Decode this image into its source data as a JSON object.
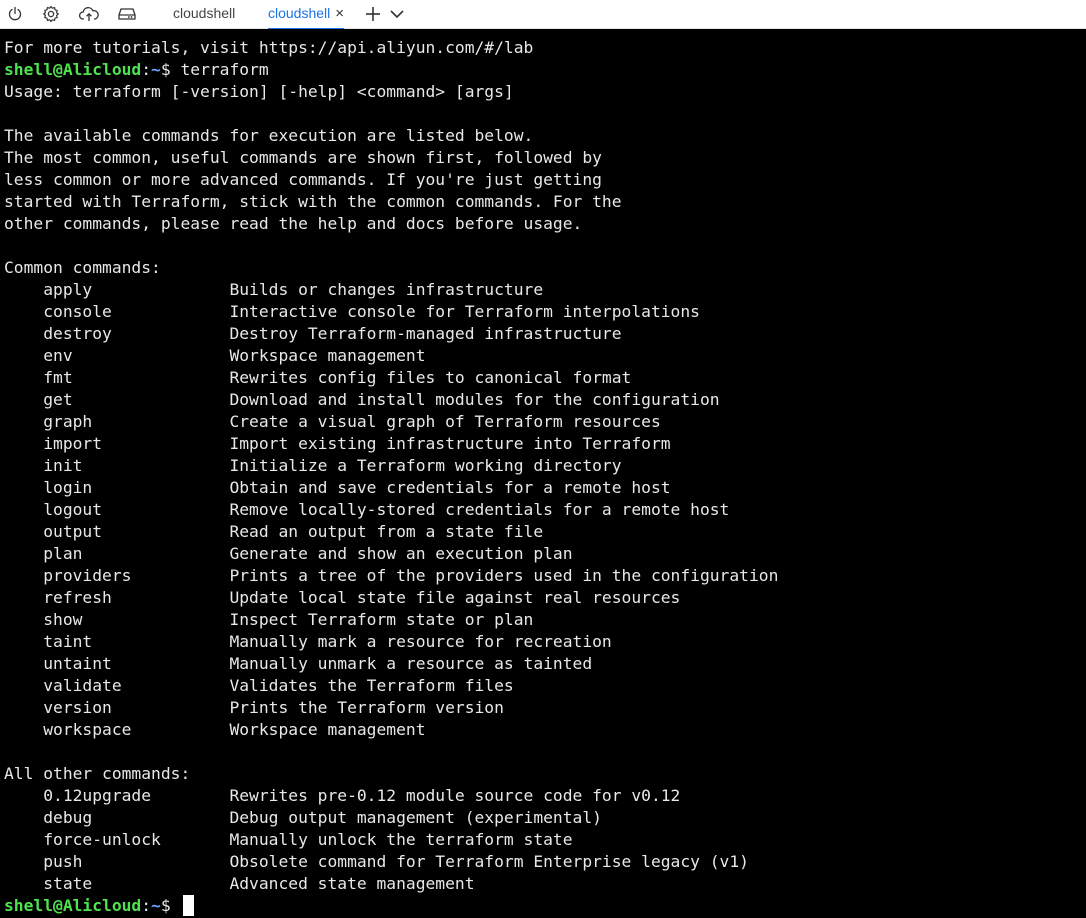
{
  "toolbar": {
    "icons": [
      "power-icon",
      "gear-icon",
      "cloud-upload-icon",
      "drive-icon"
    ],
    "tabs": [
      {
        "label": "cloudshell",
        "active": false
      },
      {
        "label": "cloudshell",
        "active": true,
        "close": "×"
      }
    ],
    "add_label": "+",
    "more_label": "chevron-down",
    "accent_color": "#1a73e8"
  },
  "terminal": {
    "colors": {
      "background": "#000000",
      "text": "#e8e8e8",
      "prompt_user": "#4ee34e",
      "prompt_path": "#6aa0ff"
    },
    "prompt": {
      "user": "shell@Alicloud",
      "path": "~",
      "symbol": "$ "
    },
    "first_command": "terraform",
    "lines": [
      "For more tutorials, visit https://api.aliyun.com/#/lab",
      "",
      "Usage: terraform [-version] [-help] <command> [args]",
      "",
      "The available commands for execution are listed below.",
      "The most common, useful commands are shown first, followed by",
      "less common or more advanced commands. If you're just getting",
      "started with Terraform, stick with the common commands. For the",
      "other commands, please read the help and docs before usage.",
      "",
      "Common commands:",
      "    apply              Builds or changes infrastructure",
      "    console            Interactive console for Terraform interpolations",
      "    destroy            Destroy Terraform-managed infrastructure",
      "    env                Workspace management",
      "    fmt                Rewrites config files to canonical format",
      "    get                Download and install modules for the configuration",
      "    graph              Create a visual graph of Terraform resources",
      "    import             Import existing infrastructure into Terraform",
      "    init               Initialize a Terraform working directory",
      "    login              Obtain and save credentials for a remote host",
      "    logout             Remove locally-stored credentials for a remote host",
      "    output             Read an output from a state file",
      "    plan               Generate and show an execution plan",
      "    providers          Prints a tree of the providers used in the configuration",
      "    refresh            Update local state file against real resources",
      "    show               Inspect Terraform state or plan",
      "    taint              Manually mark a resource for recreation",
      "    untaint            Manually unmark a resource as tainted",
      "    validate           Validates the Terraform files",
      "    version            Prints the Terraform version",
      "    workspace          Workspace management",
      "",
      "All other commands:",
      "    0.12upgrade        Rewrites pre-0.12 module source code for v0.12",
      "    debug              Debug output management (experimental)",
      "    force-unlock       Manually unlock the terraform state",
      "    push               Obsolete command for Terraform Enterprise legacy (v1)",
      "    state              Advanced state management",
      ""
    ]
  }
}
